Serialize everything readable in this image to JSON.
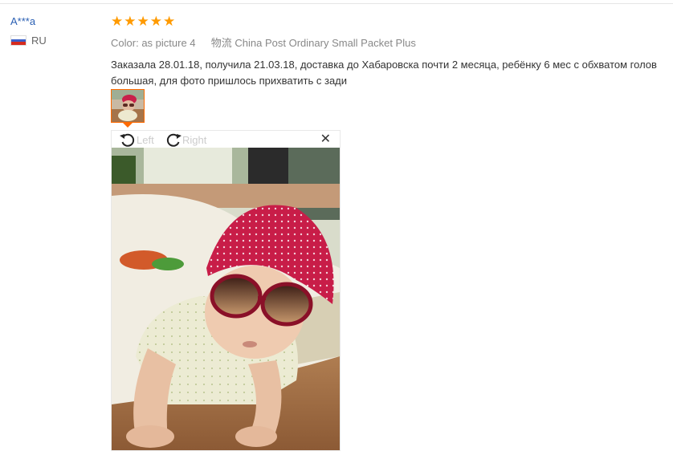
{
  "user": {
    "name": "A***a",
    "country_code": "RU"
  },
  "review": {
    "stars": 5,
    "color_label": "Color:",
    "color_value": "as picture 4",
    "logistics_label": "物流",
    "logistics_value": "China Post Ordinary Small Packet Plus",
    "text_line1": "Заказала 28.01.18, получила 21.03.18, доставка до Хабаровска почти 2 месяца, ребёнку 6 мес с обхватом голов",
    "text_line2": "большая, для фото пришлось прихватить с зади"
  },
  "viewer": {
    "rotate_left_label": "Left",
    "rotate_right_label": "Right",
    "close_glyph": "✕"
  },
  "colors": {
    "star": "#ff9a00",
    "link": "#2a5fb3",
    "accent": "#ff6a00"
  }
}
